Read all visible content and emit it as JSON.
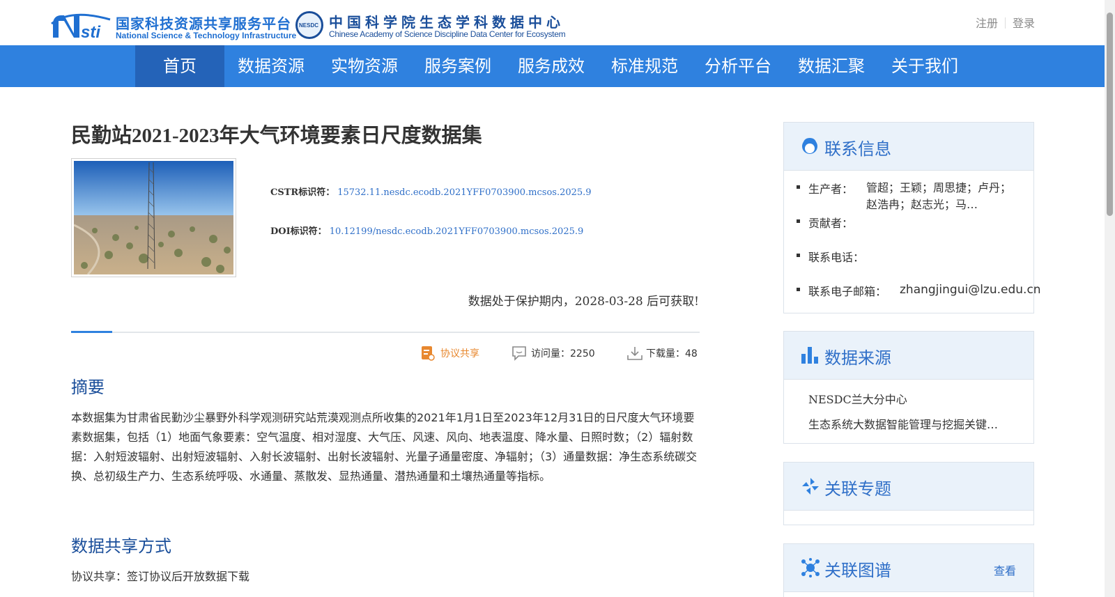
{
  "header": {
    "nstl_logo_cn": "国家科技资源共享服务平台",
    "nstl_logo_en": "National Science & Technology Infrastructure",
    "nesdc_badge": "NESDC",
    "nesdc_logo_cn": "中国科学院生态学科数据中心",
    "nesdc_logo_en": "Chinese Academy of Science Discipline Data Center for Ecosystem",
    "register": "注册",
    "login": "登录"
  },
  "nav": {
    "items": [
      "首页",
      "数据资源",
      "实物资源",
      "服务案例",
      "服务成效",
      "标准规范",
      "分析平台",
      "数据汇聚",
      "关于我们"
    ],
    "active_index": 0
  },
  "dataset": {
    "title": "民勤站2021-2023年大气环境要素日尺度数据集",
    "cstr_label": "CSTR标识符：",
    "cstr_value": "15732.11.nesdc.ecodb.2021YFF0703900.mcsos.2025.9",
    "doi_label": "DOI标识符：",
    "doi_value": "10.12199/nesdc.ecodb.2021YFF0703900.mcsos.2025.9",
    "protection_notice": "数据处于保护期内，2028-03-28 后可获取!"
  },
  "stats": {
    "share_label": "协议共享",
    "visits_label": "访问量：2250",
    "downloads_label": "下载量：48"
  },
  "abstract": {
    "heading": "摘要",
    "text": "本数据集为甘肃省民勤沙尘暴野外科学观测研究站荒漠观测点所收集的2021年1月1日至2023年12月31日的日尺度大气环境要素数据集，包括（1）地面气象要素：空气温度、相对湿度、大气压、风速、风向、地表温度、降水量、日照时数；（2）辐射数据：入射短波辐射、出射短波辐射、入射长波辐射、出射长波辐射、光量子通量密度、净辐射；（3）通量数据：净生态系统碳交换、总初级生产力、生态系统呼吸、水通量、蒸散发、显热通量、潜热通量和土壤热通量等指标。"
  },
  "share_mode": {
    "heading": "数据共享方式",
    "text": "协议共享：签订协议后开放数据下载"
  },
  "sidebar": {
    "contact": {
      "title": "联系信息",
      "producer_label": "生产者：",
      "producer_value": "管超；王颖；周思捷；卢丹；赵浩冉；赵志光；马…",
      "contributor_label": "贡献者：",
      "phone_label": "联系电话：",
      "email_label": "联系电子邮箱：",
      "email_value": "zhangjingui@lzu.edu.cn"
    },
    "source": {
      "title": "数据来源",
      "items": [
        "NESDC兰大分中心",
        "生态系统大数据智能管理与挖掘关键…"
      ]
    },
    "topic": {
      "title": "关联专题"
    },
    "graph": {
      "title": "关联图谱",
      "link": "查看"
    }
  },
  "colors": {
    "nav_bg": "#2f81df",
    "nav_active": "#2463b8",
    "heading_blue": "#1a4e9a",
    "link_blue": "#2f6fc8",
    "share_orange": "#e8882f"
  },
  "icons": {
    "contact": "user-headset-icon",
    "source": "bar-chart-icon",
    "topic": "topic-pinwheel-icon",
    "graph": "network-graph-icon",
    "share": "document-share-icon",
    "visits": "comment-icon",
    "downloads": "download-icon"
  }
}
